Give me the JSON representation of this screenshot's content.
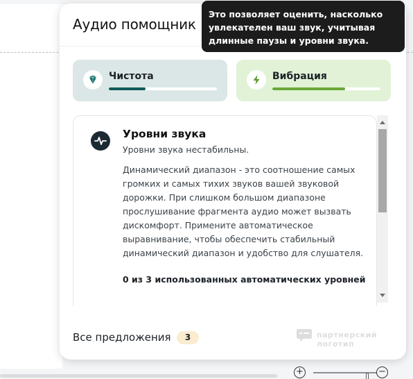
{
  "panel": {
    "title": "Аудио помощник"
  },
  "tooltip": {
    "text": "Это позволяет оценить, насколько увлекателен ваш звук, учитывая длинные паузы и уровни звука."
  },
  "metrics": [
    {
      "label": "Чистота",
      "icon": "diamond-icon",
      "progress": 0.34,
      "color": "#0f5b58"
    },
    {
      "label": "Вибрация",
      "icon": "lightning-icon",
      "progress": 0.67,
      "color": "#6aa837"
    }
  ],
  "tip": {
    "icon": "waveform-icon",
    "title": "Уровни звука",
    "subtitle": "Уровни звука нестабильны.",
    "body": "Динамический диапазон - это соотношение самых громких и самых тихих звуков вашей звуковой дорожки. При слишком большом диапазоне прослушивание фрагмента аудио может вызвать дискомфорт. Примените автоматическое выравнивание, чтобы обеспечить стабильный динамический диапазон и удобство для слушателя.",
    "usage": "0 из 3 использованных автоматических уровней"
  },
  "footer": {
    "label": "Все предложения",
    "count": "3",
    "partner_logo": "партнерский логотип"
  },
  "zoom": {
    "plus": "+",
    "minus": "−",
    "level": 0.85
  }
}
